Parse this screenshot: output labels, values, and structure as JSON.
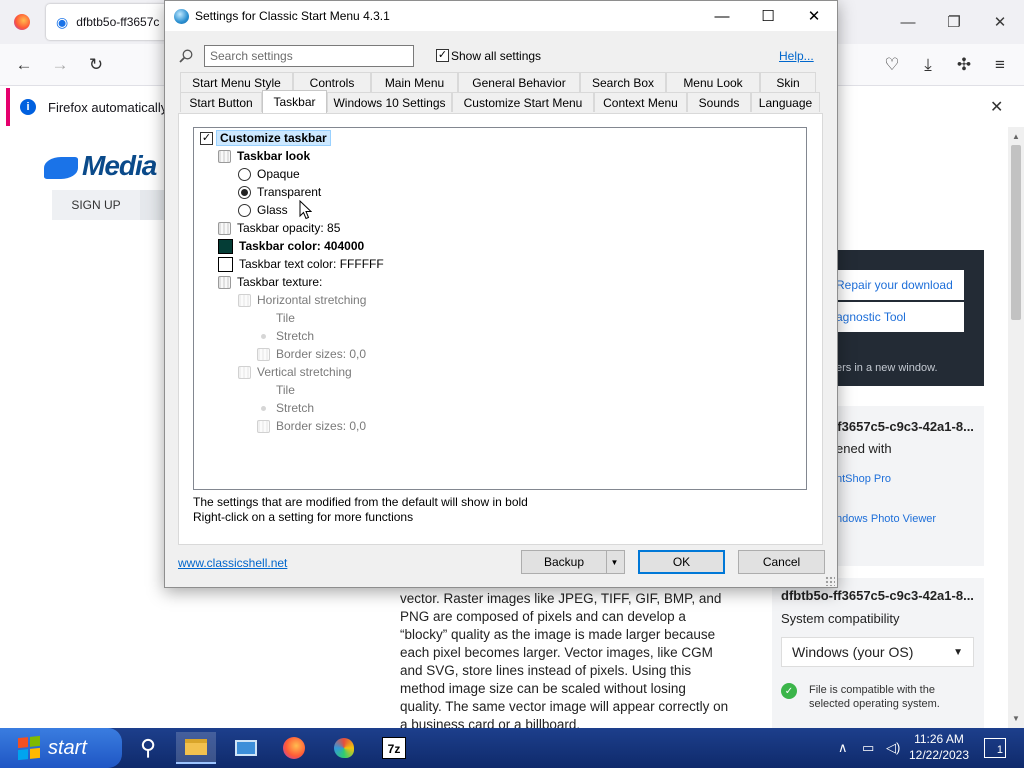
{
  "firefox": {
    "tab_title": "dfbtb5o-ff3657c",
    "notification": "Firefox automatically s",
    "page": {
      "logo_text": "Media",
      "signup_label": "SIGN UP",
      "dark_links": [
        "Repair your download",
        "agnostic Tool"
      ],
      "dark_note": "ers in a new window.",
      "file_name": "dfbtb5o-ff3657c5-c9c3-42a1-8...",
      "opened_with": "ened with",
      "app1": "ntShop Pro",
      "app2": "ndows Photo Viewer",
      "file_name2": "dfbtb5o-ff3657c5-c9c3-42a1-8...",
      "compat_label": "System compatibility",
      "os_option": "Windows (your OS)",
      "compat_text": "File is compatible with the selected operating system.",
      "article": "vector. Raster images like JPEG, TIFF, GIF, BMP, and PNG are composed of pixels and can develop a “blocky” quality as the image is made larger because each pixel becomes larger. Vector images, like CGM and SVG, store lines instead of pixels. Using this method image size can be scaled without losing quality. The same vector image will appear correctly on a business card or a billboard."
    }
  },
  "dialog": {
    "title": "Settings for Classic Start Menu 4.3.1",
    "search_placeholder": "Search settings",
    "show_all_label": "Show all settings",
    "help_label": "Help...",
    "tabs_row1": [
      "Start Menu Style",
      "Controls",
      "Main Menu",
      "General Behavior",
      "Search Box",
      "Menu Look",
      "Skin"
    ],
    "tabs_row2": [
      "Start Button",
      "Taskbar",
      "Windows 10 Settings",
      "Customize Start Menu",
      "Context Menu",
      "Sounds",
      "Language"
    ],
    "active_tab": "Taskbar",
    "tree": {
      "customize_taskbar": "Customize taskbar",
      "taskbar_look": "Taskbar look",
      "opaque": "Opaque",
      "transparent": "Transparent",
      "glass": "Glass",
      "opacity": "Taskbar opacity: 85",
      "color": "Taskbar color: 404000",
      "text_color": "Taskbar text color: FFFFFF",
      "texture": "Taskbar texture:",
      "h_stretch": "Horizontal stretching",
      "h_tile": "Tile",
      "h_stretch_opt": "Stretch",
      "h_border": "Border sizes: 0,0",
      "v_stretch": "Vertical stretching",
      "v_tile": "Tile",
      "v_stretch_opt": "Stretch",
      "v_border": "Border sizes: 0,0"
    },
    "hint1": "The settings that are modified from the default will show in bold",
    "hint2": "Right-click on a setting for more functions",
    "site_link": "www.classicshell.net",
    "backup_label": "Backup",
    "ok_label": "OK",
    "cancel_label": "Cancel"
  },
  "taskbar": {
    "start_label": "start",
    "time": "11:26 AM",
    "date": "12/22/2023",
    "notification_count": "1"
  },
  "colors": {
    "taskbar_swatch": "#043d36",
    "text_swatch": "#ffffff",
    "link": "#0066cc",
    "accent": "#0078d7"
  }
}
